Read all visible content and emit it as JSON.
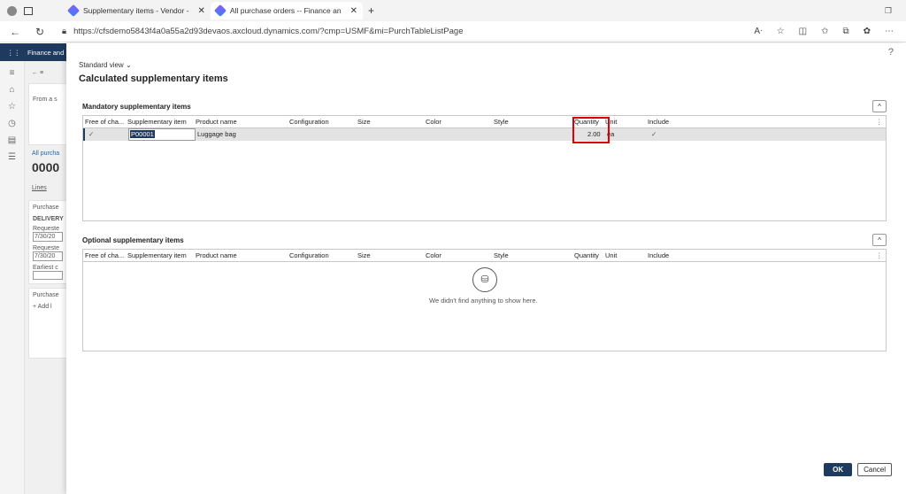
{
  "browser": {
    "tabs": [
      {
        "title": "Supplementary items - Vendor -"
      },
      {
        "title": "All purchase orders -- Finance an"
      }
    ],
    "url": "https://cfsdemo5843f4a0a55a2d93devaos.axcloud.dynamics.com/?cmp=USMF&mi=PurchTableListPage"
  },
  "app": {
    "name": "Finance and",
    "bg": {
      "from_label": "From a s",
      "all_purch": "All purcha",
      "order_num": "0000",
      "lines_tab": "Lines",
      "purchase1": "Purchase",
      "delivery": "DELIVERY",
      "requested1": "Requeste",
      "date1": "7/30/20",
      "requested2": "Requeste",
      "date2": "7/30/20",
      "earliest": "Earliest c",
      "purchase2": "Purchase",
      "add_label": "+ Add l"
    }
  },
  "dialog": {
    "view_selector": "Standard view",
    "title": "Calculated supplementary items",
    "help": "?",
    "mandatory": {
      "title": "Mandatory supplementary items",
      "columns": [
        "Free of cha...",
        "Supplementary item",
        "Product name",
        "Configuration",
        "Size",
        "Color",
        "Style",
        "Quantity",
        "Unit",
        "Include"
      ],
      "rows": [
        {
          "free_of_charge": "✓",
          "item": "P00001",
          "product_name": "Luggage bag",
          "configuration": "",
          "size": "",
          "color": "",
          "style": "",
          "quantity": "2.00",
          "unit": "ea",
          "include": "✓"
        }
      ]
    },
    "optional": {
      "title": "Optional supplementary items",
      "columns": [
        "Free of cha...",
        "Supplementary item",
        "Product name",
        "Configuration",
        "Size",
        "Color",
        "Style",
        "Quantity",
        "Unit",
        "Include"
      ],
      "empty_message": "We didn't find anything to show here."
    },
    "ok_label": "OK",
    "cancel_label": "Cancel"
  }
}
